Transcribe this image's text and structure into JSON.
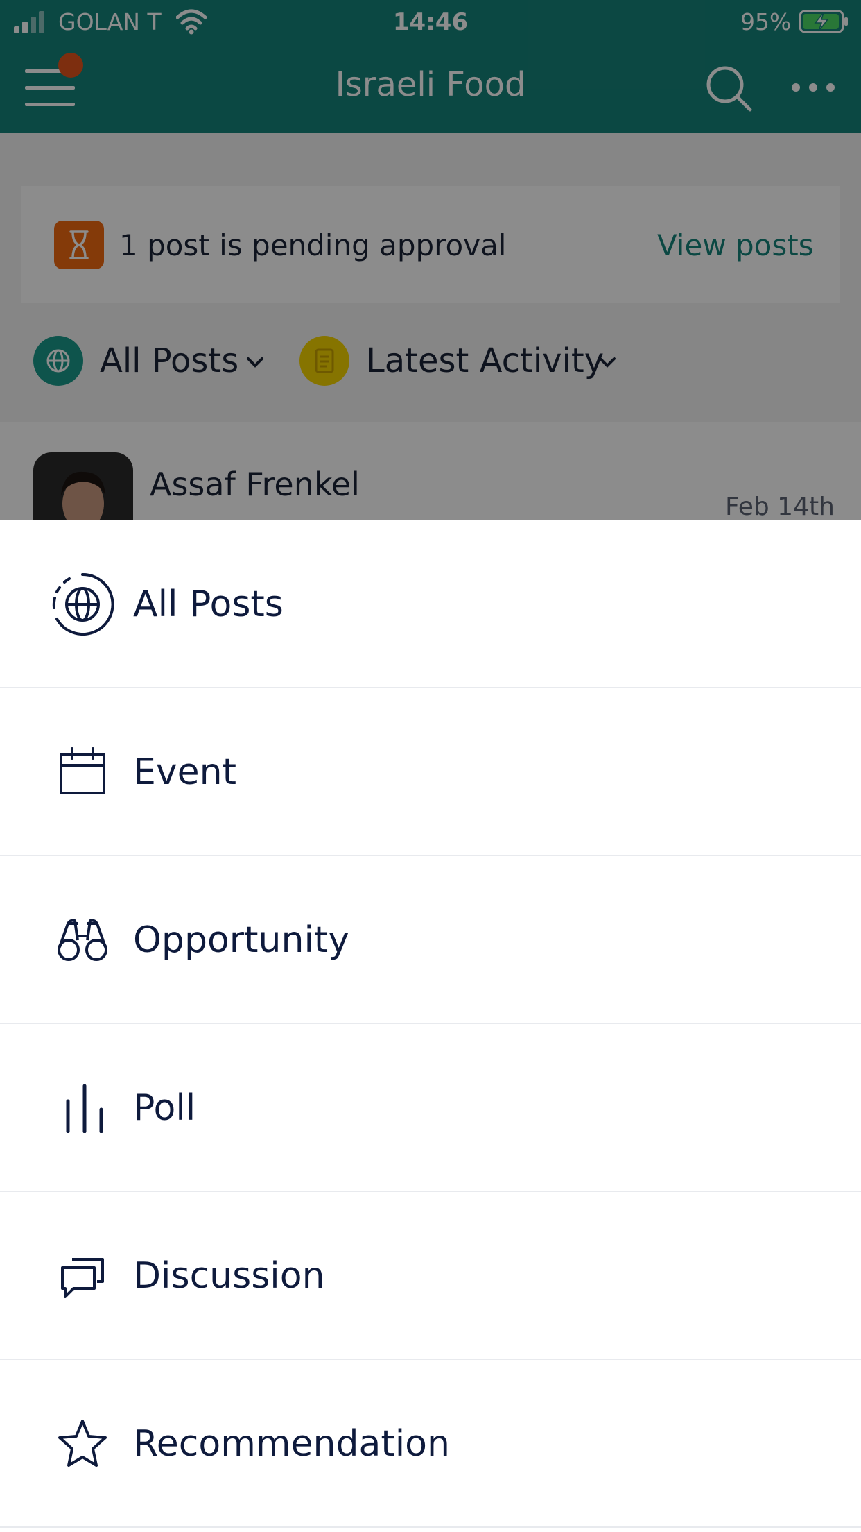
{
  "status_bar": {
    "carrier": "GOLAN T",
    "time": "14:46",
    "battery": "95%"
  },
  "header": {
    "title": "Israeli Food"
  },
  "pending_banner": {
    "text": "1 post is pending approval",
    "action": "View posts"
  },
  "filters": {
    "type_label": "All Posts",
    "sort_label": "Latest Activity"
  },
  "post": {
    "author": "Assaf Frenkel",
    "date": "Feb 14th"
  },
  "menu": {
    "items": [
      {
        "label": "All Posts",
        "icon": "globe-icon"
      },
      {
        "label": "Event",
        "icon": "calendar-icon"
      },
      {
        "label": "Opportunity",
        "icon": "binoculars-icon"
      },
      {
        "label": "Poll",
        "icon": "poll-icon"
      },
      {
        "label": "Discussion",
        "icon": "chat-bubbles-icon"
      },
      {
        "label": "Recommendation",
        "icon": "star-icon"
      }
    ]
  },
  "colors": {
    "brand": "#15837a",
    "text": "#0e1a3c",
    "pending": "#f06a12",
    "accent_yellow": "#f5d400"
  }
}
